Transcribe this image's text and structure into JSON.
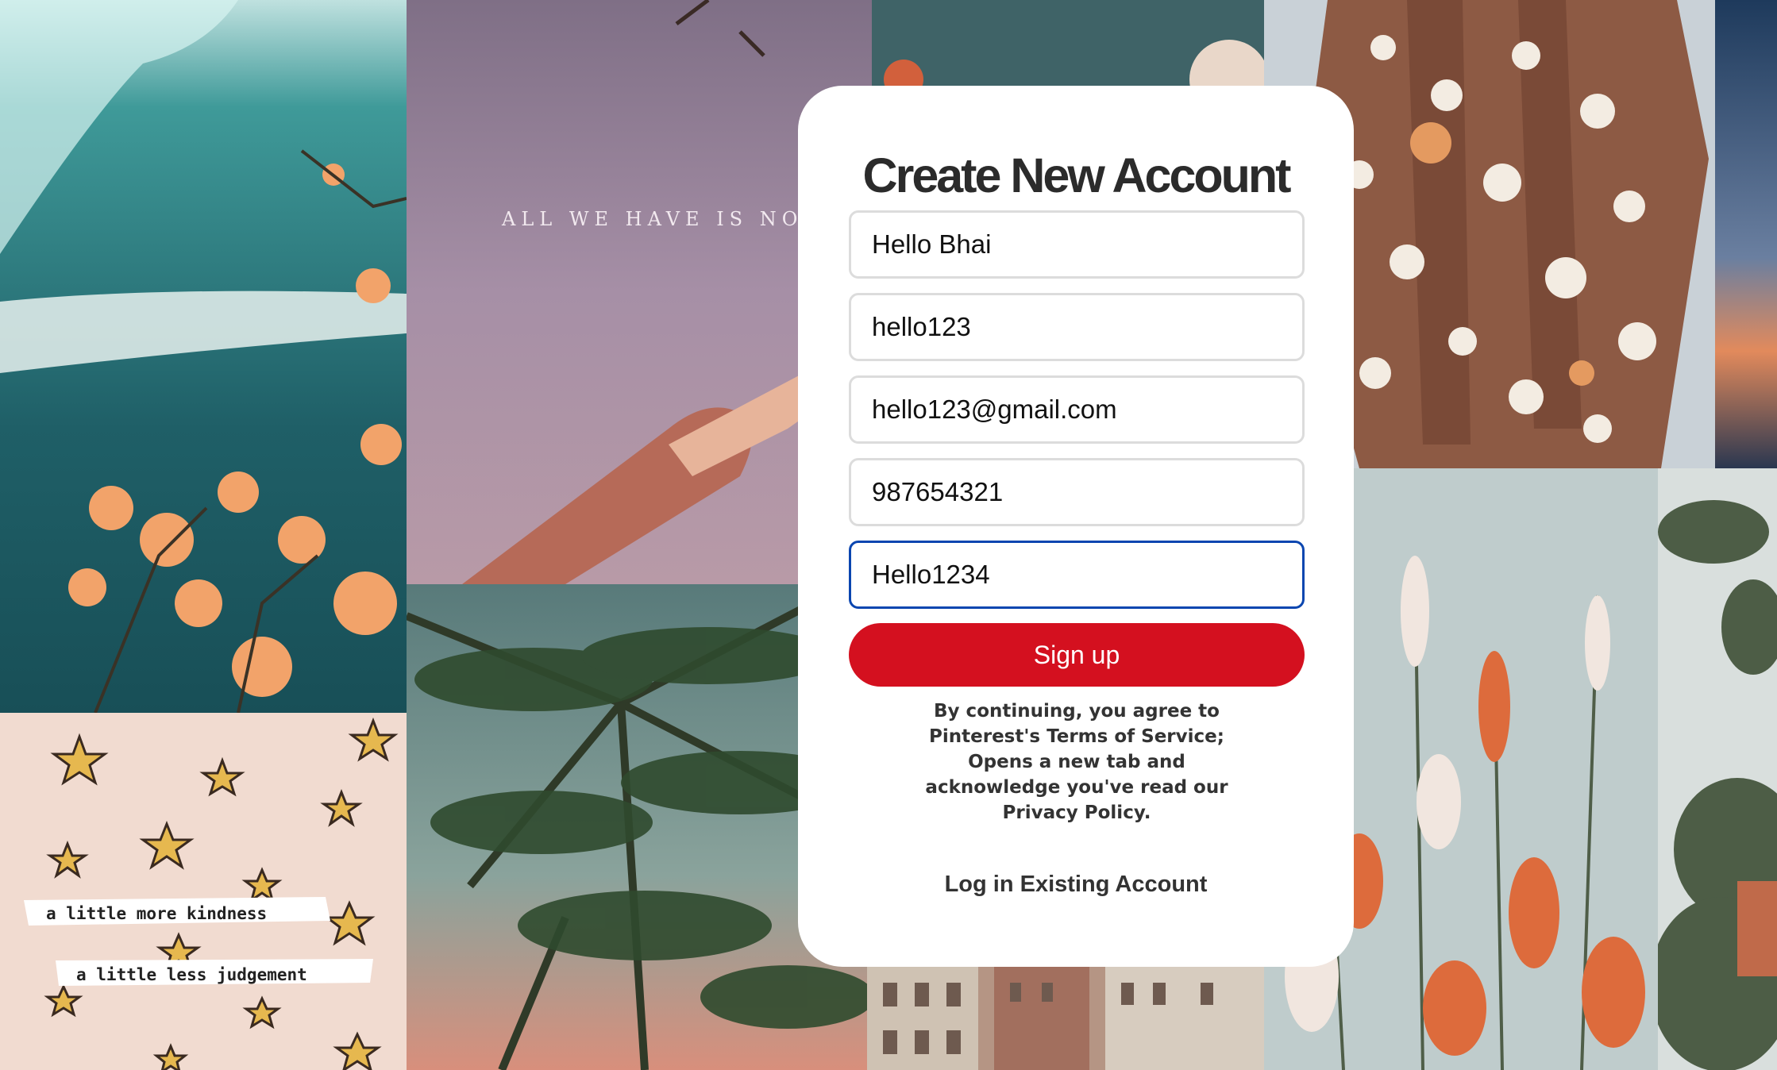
{
  "signup_card": {
    "title": "Create New Account",
    "fields": [
      {
        "value": "Hello Bhai"
      },
      {
        "value": "hello123"
      },
      {
        "value": "hello123@gmail.com"
      },
      {
        "value": "987654321"
      },
      {
        "value": "Hello1234",
        "focused": true
      }
    ],
    "signup_label": "Sign up",
    "terms_text": "By continuing, you agree to Pinterest's Terms of Service; Opens a new tab and acknowledge you've read our Privacy Policy.",
    "login_label": "Log in Existing Account"
  },
  "background": {
    "sky_caption": "ALL WE HAVE IS NOW",
    "stars_line1": "a little more kindness",
    "stars_line2": "a little less judgement"
  },
  "colors": {
    "accent": "#d4101f",
    "focus_border": "#0b46b0",
    "card_bg": "#ffffff"
  }
}
